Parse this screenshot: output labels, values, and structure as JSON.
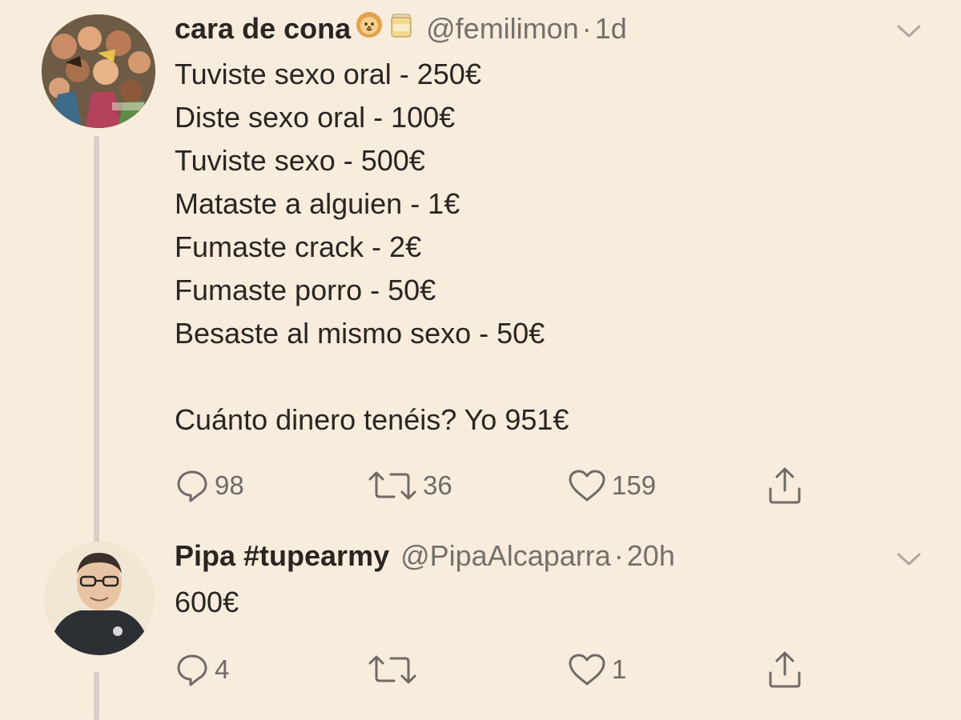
{
  "tweets": [
    {
      "display_name": "cara de cona",
      "badges": [
        "lion-face-icon",
        "honey-pot-icon"
      ],
      "handle": "@femilimon",
      "separator": "·",
      "time": "1d",
      "lines": [
        "Tuviste sexo oral - 250€",
        "Diste sexo oral - 100€",
        "Tuviste sexo - 500€",
        "Mataste a alguien - 1€",
        "Fumaste crack - 2€",
        "Fumaste porro - 50€",
        "Besaste al mismo sexo - 50€"
      ],
      "question": "Cuánto dinero tenéis? Yo 951€",
      "replies": "98",
      "retweets": "36",
      "likes": "159"
    },
    {
      "display_name": "Pipa #tupearmy",
      "handle": "@PipaAlcaparra",
      "separator": "·",
      "time": "20h",
      "text": "600€",
      "replies": "4",
      "retweets": "",
      "likes": "1"
    }
  ],
  "colors": {
    "background": "#f8ecdc",
    "text": "#2a2522",
    "muted": "#75706b",
    "thread_line": "#d9cfc4"
  }
}
